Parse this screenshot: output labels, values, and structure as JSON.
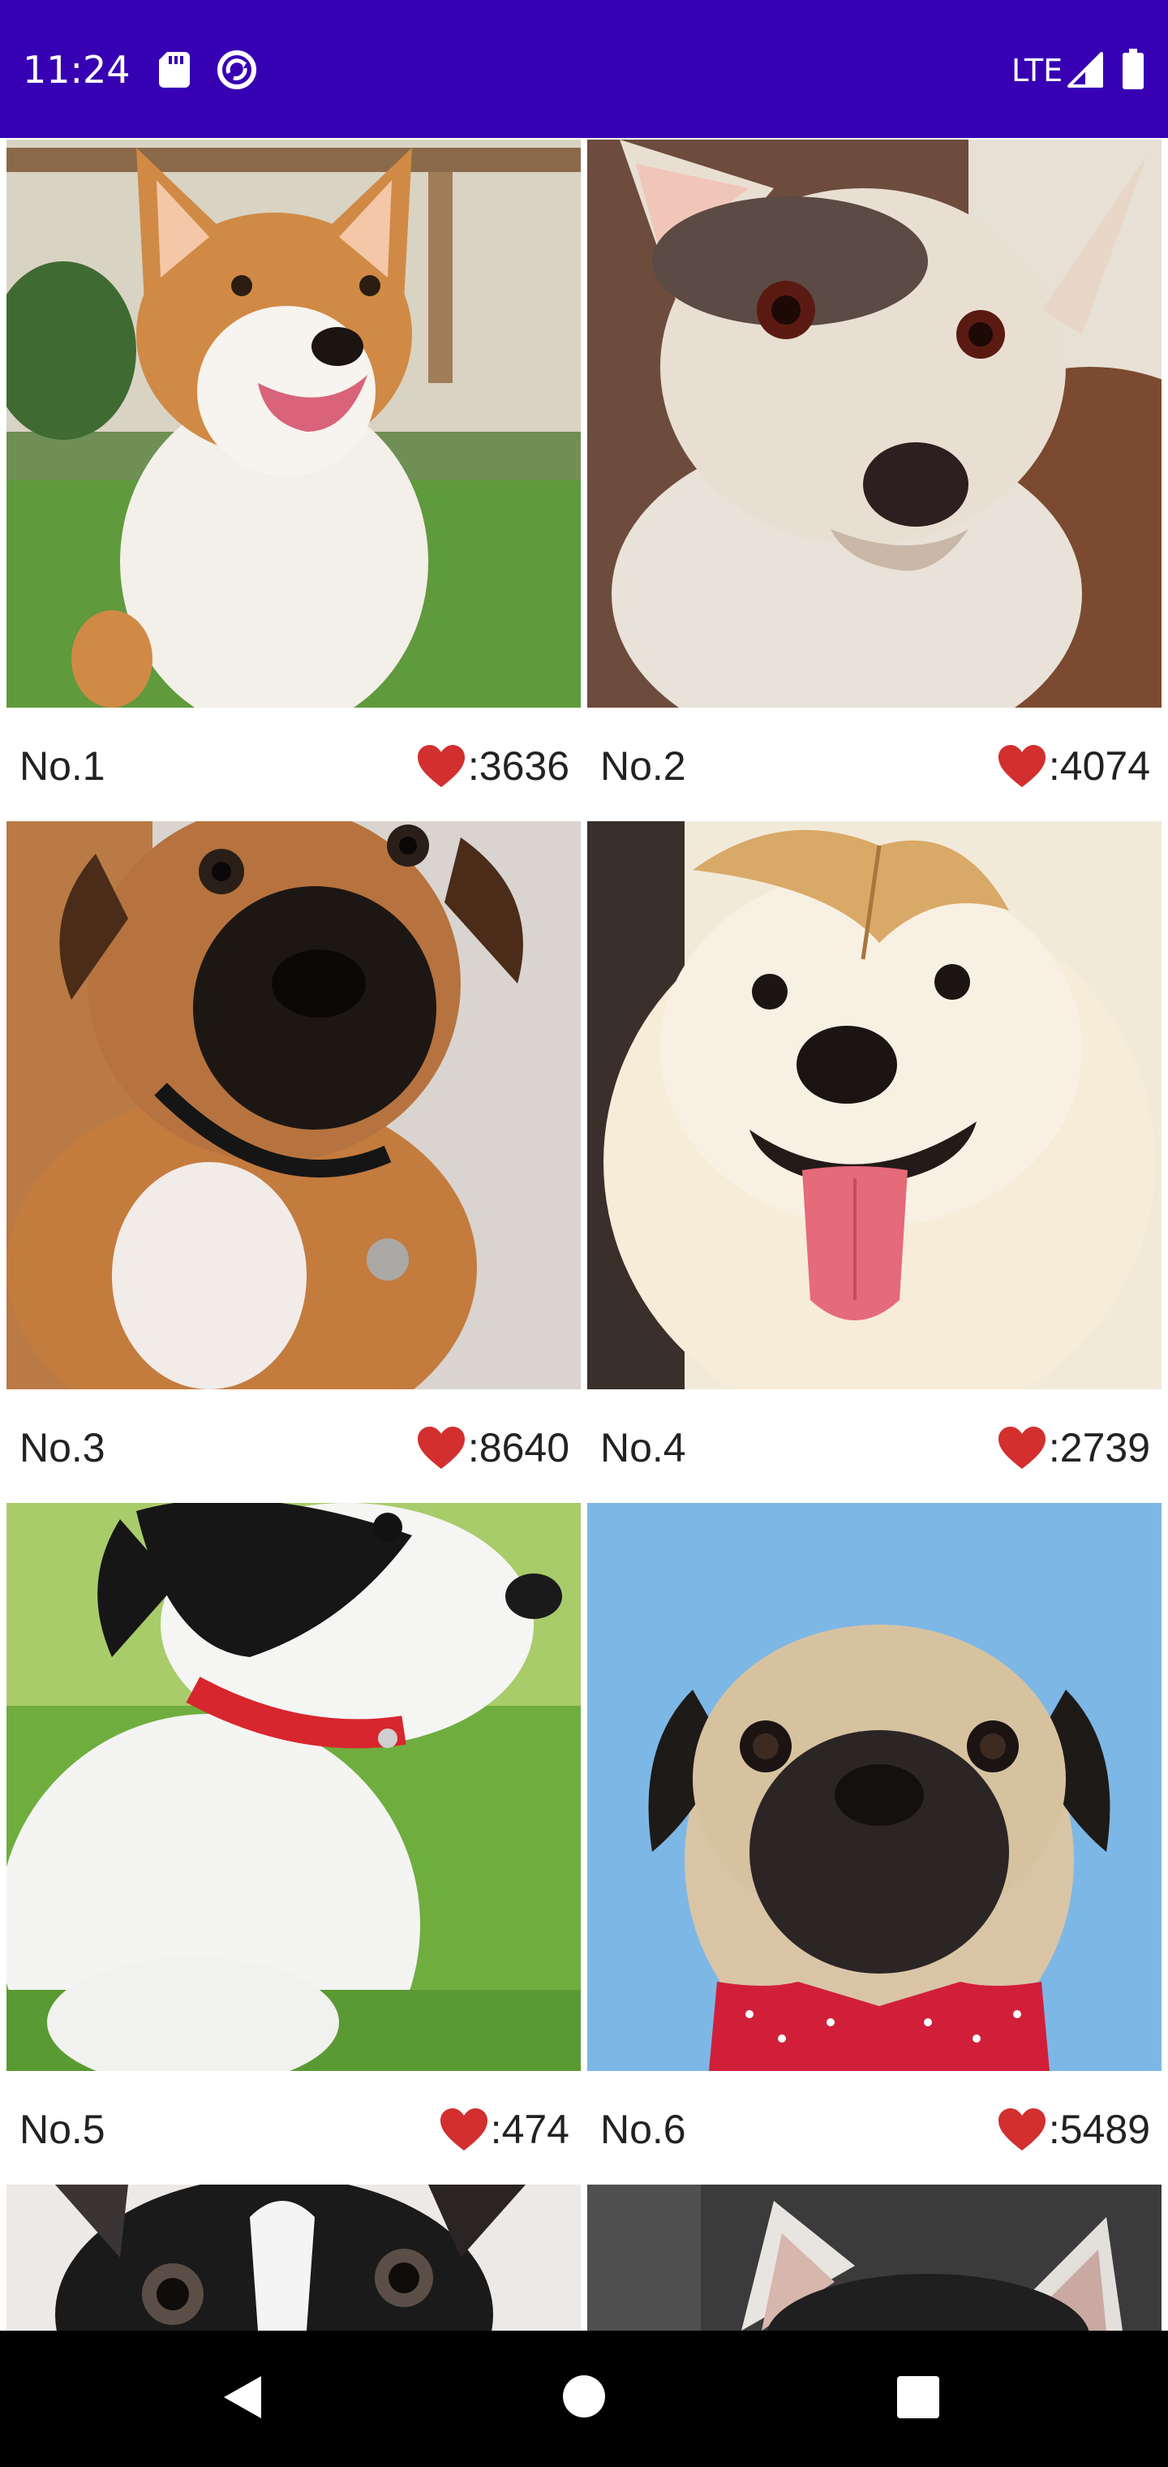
{
  "status_bar": {
    "time": "11:24",
    "network": "LTE",
    "background": "#3700b3",
    "icons": [
      "sd-card-icon",
      "sync-icon",
      "signal-icon",
      "battery-icon"
    ]
  },
  "cards": [
    {
      "number": "No.1",
      "likes": ":3636"
    },
    {
      "number": "No.2",
      "likes": ":4074"
    },
    {
      "number": "No.3",
      "likes": ":8640"
    },
    {
      "number": "No.4",
      "likes": ":2739"
    },
    {
      "number": "No.5",
      "likes": ":474"
    },
    {
      "number": "No.6",
      "likes": ":5489"
    }
  ],
  "like_icon": "heart-icon",
  "like_color": "#d32f2f",
  "nav_bar": {
    "icons": [
      "back-icon",
      "home-icon",
      "recents-icon"
    ],
    "background": "#000000"
  }
}
